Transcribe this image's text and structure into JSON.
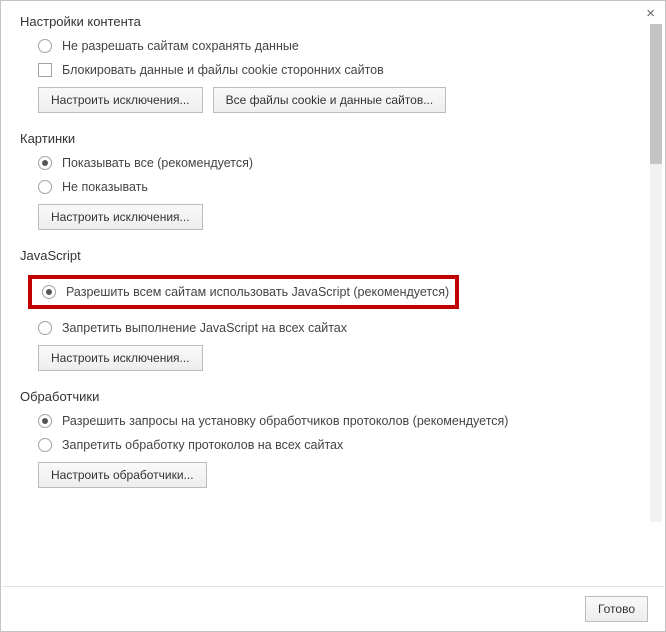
{
  "close_symbol": "×",
  "sections": {
    "content_settings": {
      "title": "Настройки контента",
      "radio_no_save": "Не разрешать сайтам сохранять данные",
      "checkbox_block_third_party": "Блокировать данные и файлы cookie сторонних сайтов",
      "btn_exceptions": "Настроить исключения...",
      "btn_all_cookies": "Все файлы cookie и данные сайтов..."
    },
    "images": {
      "title": "Картинки",
      "radio_show_all": "Показывать все (рекомендуется)",
      "radio_no_show": "Не показывать",
      "btn_exceptions": "Настроить исключения..."
    },
    "javascript": {
      "title": "JavaScript",
      "radio_allow": "Разрешить всем сайтам использовать JavaScript (рекомендуется)",
      "radio_block": "Запретить выполнение JavaScript на всех сайтах",
      "btn_exceptions": "Настроить исключения..."
    },
    "handlers": {
      "title": "Обработчики",
      "radio_allow": "Разрешить запросы на установку обработчиков протоколов (рекомендуется)",
      "radio_block": "Запретить обработку протоколов на всех сайтах",
      "btn_handlers": "Настроить обработчики..."
    }
  },
  "footer": {
    "done": "Готово"
  }
}
